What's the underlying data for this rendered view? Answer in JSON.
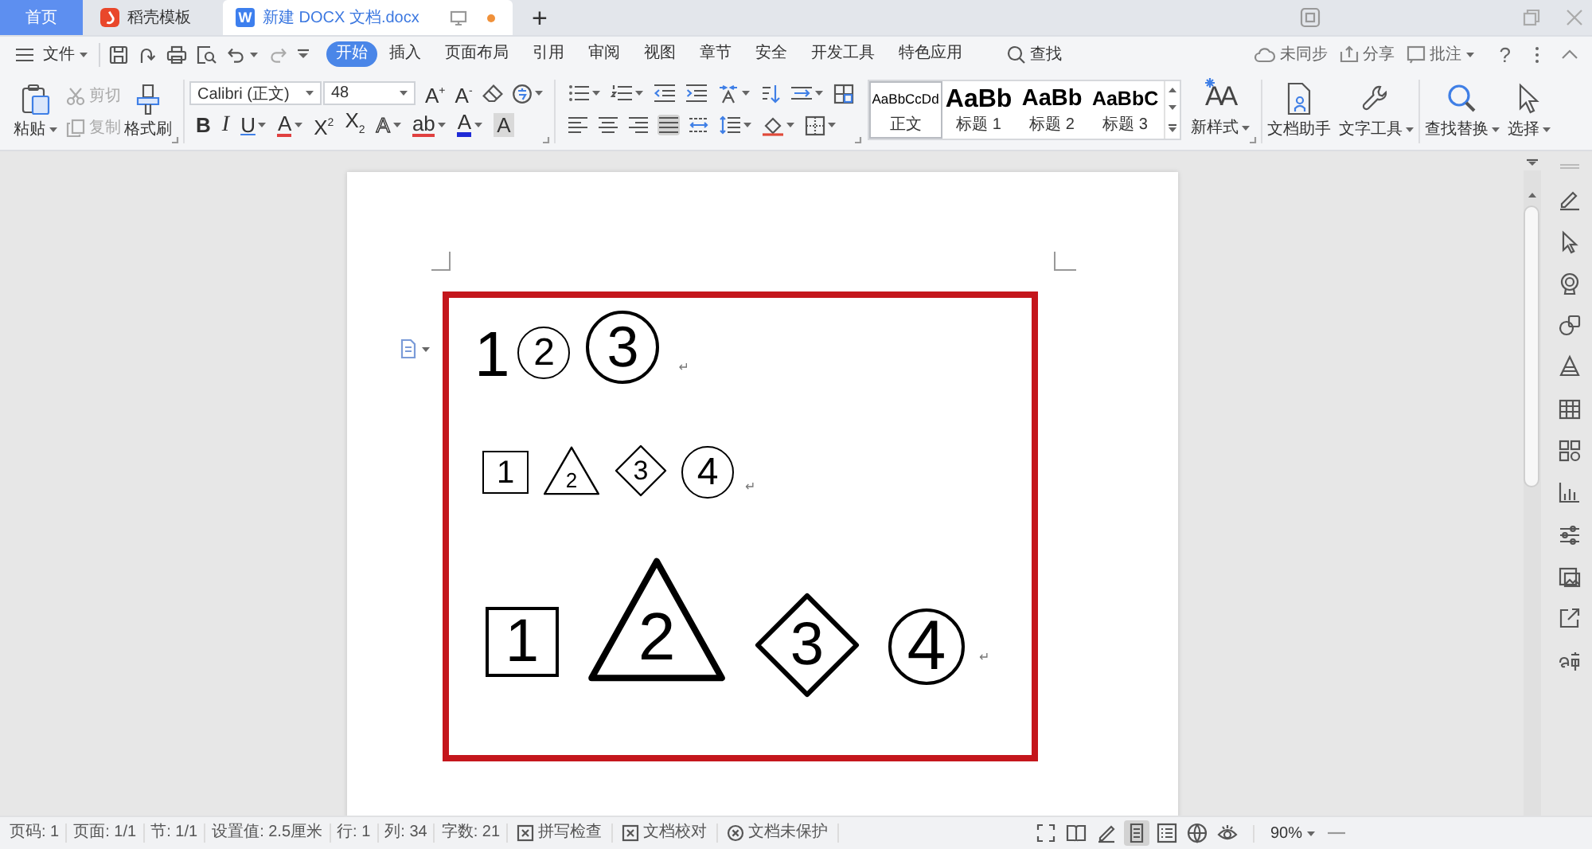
{
  "tabs": [
    {
      "label": "首页",
      "kind": "home",
      "selected": false
    },
    {
      "label": "稻壳模板",
      "kind": "docer",
      "selected": false
    },
    {
      "label": "新建 DOCX 文档.docx",
      "kind": "document",
      "selected": true,
      "badge": "W",
      "unsaved": true
    }
  ],
  "new_tab": "+",
  "menu": {
    "file": "文件",
    "items": [
      {
        "label": "开始",
        "selected": true
      },
      {
        "label": "插入",
        "selected": false
      },
      {
        "label": "页面布局",
        "selected": false
      },
      {
        "label": "引用",
        "selected": false
      },
      {
        "label": "审阅",
        "selected": false
      },
      {
        "label": "视图",
        "selected": false
      },
      {
        "label": "章节",
        "selected": false
      },
      {
        "label": "安全",
        "selected": false
      },
      {
        "label": "开发工具",
        "selected": false
      },
      {
        "label": "特色应用",
        "selected": false
      }
    ],
    "search": "查找",
    "sync": "未同步",
    "share": "分享",
    "comment": "批注",
    "help": "?"
  },
  "ribbon": {
    "clipboard": {
      "paste": "粘贴",
      "cut": {
        "label": "剪切",
        "disabled": true
      },
      "copy": {
        "label": "复制",
        "disabled": true
      },
      "format_painter": "格式刷"
    },
    "font": {
      "name": "Calibri (正文)",
      "size": "48",
      "row1": [
        {
          "kind": "grow",
          "text": "A$^{+}$",
          "dropdown": false
        },
        {
          "kind": "shrink",
          "text": "A$^{-}$",
          "dropdown": false
        },
        {
          "kind": "clear",
          "dropdown": false
        },
        {
          "kind": "phonetic",
          "dropdown": true
        }
      ],
      "row2": [
        {
          "kind": "bold",
          "text": "B",
          "dropdown": false
        },
        {
          "kind": "italic",
          "text": "I",
          "dropdown": false
        },
        {
          "kind": "underline",
          "text": "U",
          "dropdown": true
        },
        {
          "kind": "strike",
          "text": "A",
          "dropdown": true
        },
        {
          "kind": "superscript",
          "text": "X$^{2}$",
          "dropdown": false
        },
        {
          "kind": "subscript",
          "text": "X$_{2}$",
          "dropdown": false
        },
        {
          "kind": "effect",
          "text": "A",
          "dropdown": true
        },
        {
          "kind": "highlight",
          "text": "ab",
          "dropdown": true
        },
        {
          "kind": "color",
          "text": "A",
          "dropdown": true
        },
        {
          "kind": "shade",
          "text": "A",
          "dropdown": false
        }
      ]
    },
    "paragraph": {
      "row1": [
        {
          "kind": "bullets",
          "dropdown": true
        },
        {
          "kind": "numbering",
          "dropdown": true
        },
        {
          "kind": "outdent",
          "dropdown": false
        },
        {
          "kind": "indent",
          "dropdown": false
        },
        {
          "kind": "layout",
          "dropdown": true
        },
        {
          "kind": "sort",
          "dropdown": false
        },
        {
          "kind": "wrap",
          "dropdown": true
        },
        {
          "kind": "marks",
          "dropdown": false
        }
      ],
      "row2": [
        {
          "kind": "align-left",
          "selected": false,
          "dropdown": false
        },
        {
          "kind": "align-center",
          "selected": false,
          "dropdown": false
        },
        {
          "kind": "align-right",
          "selected": false,
          "dropdown": false
        },
        {
          "kind": "justify",
          "selected": true,
          "dropdown": false
        },
        {
          "kind": "distribute",
          "selected": false,
          "dropdown": false
        },
        {
          "kind": "spacing",
          "selected": false,
          "dropdown": true
        },
        {
          "kind": "shading",
          "selected": false,
          "dropdown": true
        },
        {
          "kind": "borders",
          "selected": false,
          "dropdown": true
        }
      ]
    },
    "styles": [
      {
        "preview": "AaBbCcDd",
        "label": "正文",
        "selected": true
      },
      {
        "preview": "AaBb",
        "label": "标题 1",
        "selected": false
      },
      {
        "preview": "AaBb",
        "label": "标题 2",
        "selected": false
      },
      {
        "preview": "AaBbC",
        "label": "标题 3",
        "selected": false
      }
    ],
    "new_style": {
      "icon_text": "AA",
      "label": "新样式"
    },
    "doc_assistant": "文档助手",
    "text_tools": "文字工具",
    "find_replace": "查找替换",
    "select": "选择"
  },
  "document": {
    "lines": [
      {
        "items": [
          {
            "kind": "plain",
            "text": "1"
          },
          {
            "kind": "circle",
            "text": "2"
          },
          {
            "kind": "circle",
            "text": "3"
          }
        ],
        "mark": "↵"
      },
      {
        "items": [
          {
            "kind": "square",
            "text": "1"
          },
          {
            "kind": "triangle",
            "text": "2"
          },
          {
            "kind": "diamond",
            "text": "3"
          },
          {
            "kind": "circle",
            "text": "4"
          }
        ],
        "mark": "↵"
      },
      {
        "items": [
          {
            "kind": "square",
            "text": "1"
          },
          {
            "kind": "triangle",
            "text": "2"
          },
          {
            "kind": "diamond",
            "text": "3"
          },
          {
            "kind": "circle",
            "text": "4"
          }
        ],
        "mark": "↵"
      }
    ]
  },
  "status_bar": {
    "fields": [
      "页码: 1",
      "页面: 1/1",
      "节: 1/1",
      "设置值: 2.5厘米",
      "行: 1",
      "列: 34",
      "字数: 21"
    ],
    "toggles": [
      {
        "label": "拼写检查",
        "kind": "check"
      },
      {
        "label": "文档校对",
        "kind": "check"
      },
      {
        "label": "文档未保护",
        "kind": "protect"
      }
    ],
    "views": [
      {
        "kind": "fullscreen",
        "selected": false
      },
      {
        "kind": "reading",
        "selected": false
      },
      {
        "kind": "pen",
        "selected": false
      },
      {
        "kind": "page",
        "selected": true
      },
      {
        "kind": "outline",
        "selected": false
      },
      {
        "kind": "web",
        "selected": false
      },
      {
        "kind": "eye",
        "selected": false
      }
    ],
    "zoom": "90%"
  }
}
